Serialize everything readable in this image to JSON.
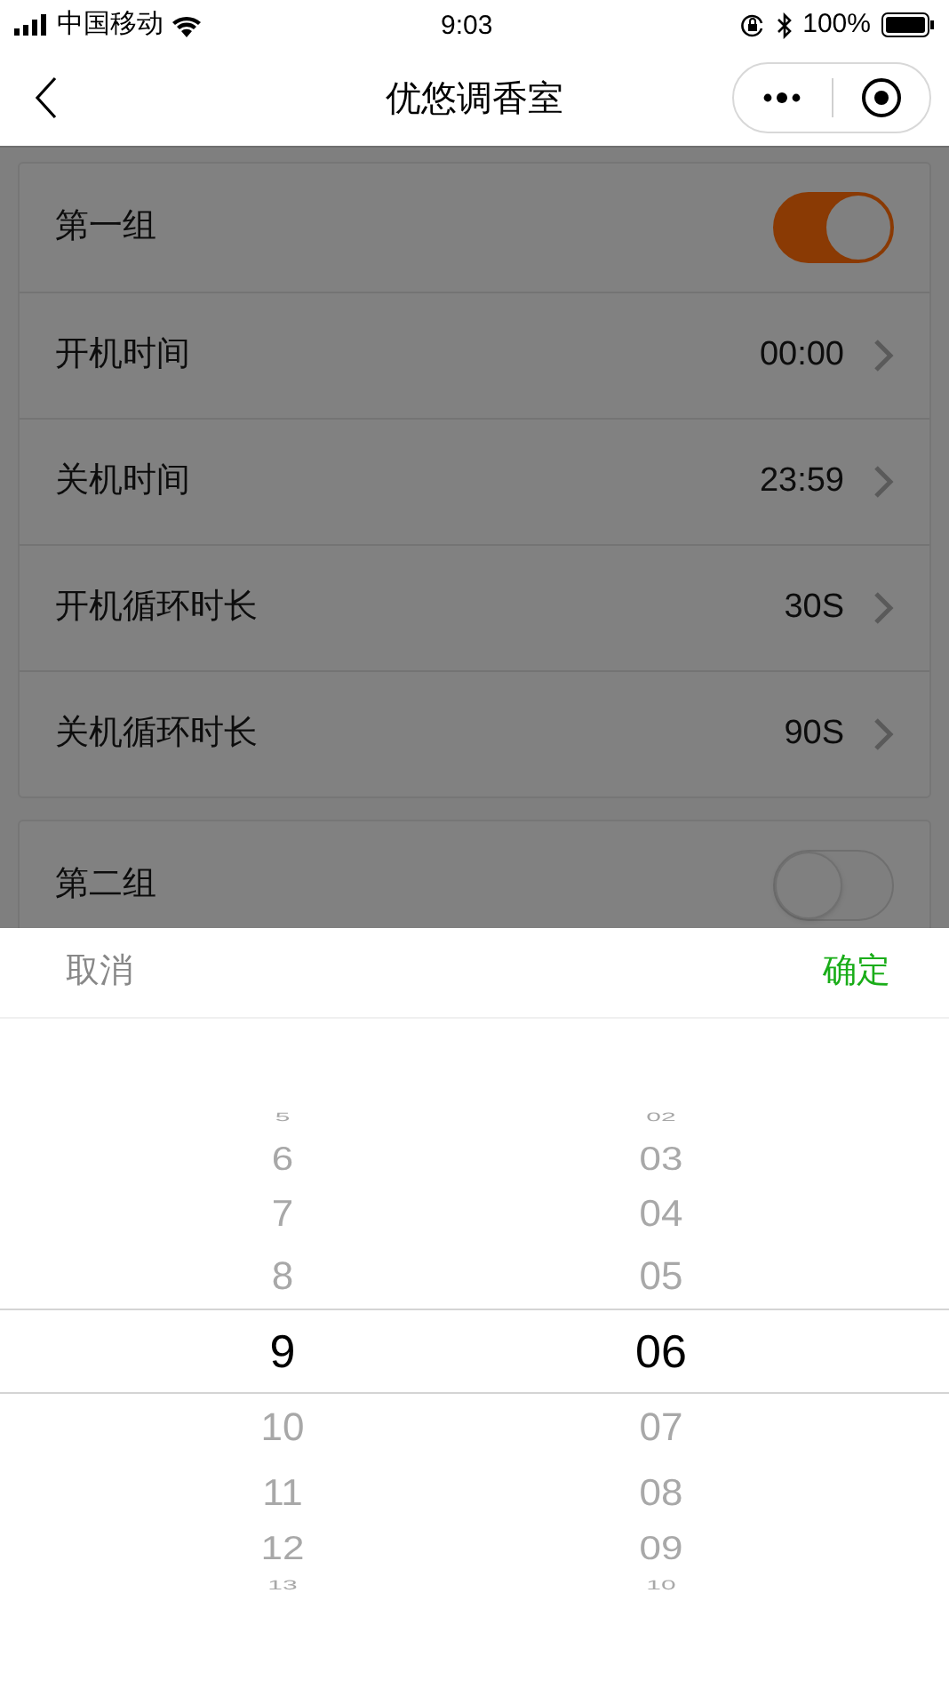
{
  "status_bar": {
    "carrier": "中国移动",
    "time": "9:03",
    "battery": "100%"
  },
  "nav": {
    "title": "优悠调香室"
  },
  "groups": [
    {
      "title": "第一组",
      "on": true,
      "rows": [
        {
          "label": "开机时间",
          "value": "00:00"
        },
        {
          "label": "关机时间",
          "value": "23:59"
        },
        {
          "label": "开机循环时长",
          "value": "30S"
        },
        {
          "label": "关机循环时长",
          "value": "90S"
        }
      ]
    },
    {
      "title": "第二组",
      "on": false
    }
  ],
  "picker": {
    "cancel": "取消",
    "confirm": "确定",
    "columns": [
      {
        "items": [
          {
            "text": "5",
            "selected": false
          },
          {
            "text": "6",
            "selected": false
          },
          {
            "text": "7",
            "selected": false
          },
          {
            "text": "8",
            "selected": false
          },
          {
            "text": "9",
            "selected": true
          },
          {
            "text": "10",
            "selected": false
          },
          {
            "text": "11",
            "selected": false
          },
          {
            "text": "12",
            "selected": false
          },
          {
            "text": "13",
            "selected": false
          }
        ]
      },
      {
        "items": [
          {
            "text": "02",
            "selected": false
          },
          {
            "text": "03",
            "selected": false
          },
          {
            "text": "04",
            "selected": false
          },
          {
            "text": "05",
            "selected": false
          },
          {
            "text": "06",
            "selected": true
          },
          {
            "text": "07",
            "selected": false
          },
          {
            "text": "08",
            "selected": false
          },
          {
            "text": "09",
            "selected": false
          },
          {
            "text": "10",
            "selected": false
          }
        ]
      }
    ]
  }
}
